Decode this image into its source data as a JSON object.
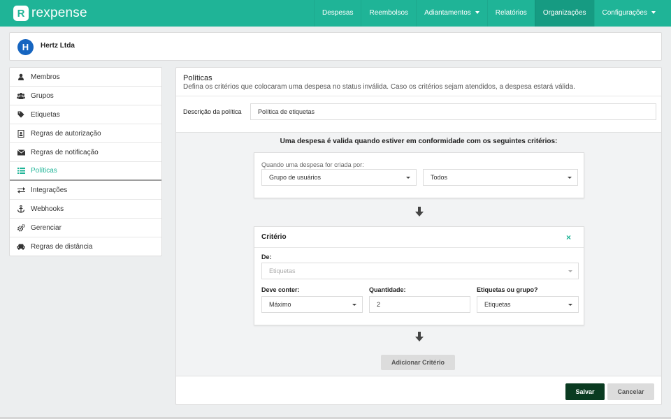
{
  "brand": {
    "logo_letter": "R",
    "name": "rexpense"
  },
  "nav": [
    {
      "label": "Despesas"
    },
    {
      "label": "Reembolsos"
    },
    {
      "label": "Adiantamentos"
    },
    {
      "label": "Relatórios"
    },
    {
      "label": "Organizações"
    },
    {
      "label": "Configurações"
    }
  ],
  "company": {
    "initial": "H",
    "name": "Hertz Ltda"
  },
  "sidebar": {
    "items": [
      {
        "label": "Membros",
        "icon": "user-icon"
      },
      {
        "label": "Grupos",
        "icon": "users-icon"
      },
      {
        "label": "Etiquetas",
        "icon": "tag-icon"
      },
      {
        "label": "Regras de autorização",
        "icon": "badge-icon"
      },
      {
        "label": "Regras de notificação",
        "icon": "envelope-icon"
      },
      {
        "label": "Políticas",
        "icon": "list-icon"
      },
      {
        "label": "Integrações",
        "icon": "exchange-icon"
      },
      {
        "label": "Webhooks",
        "icon": "anchor-icon"
      },
      {
        "label": "Gerenciar",
        "icon": "gears-icon"
      },
      {
        "label": "Regras de distância",
        "icon": "car-icon"
      }
    ]
  },
  "panel": {
    "title": "Políticas",
    "subtitle": "Defina os critérios que colocaram uma despesa no status inválida. Caso os critérios sejam atendidos, a despesa estará válida.",
    "description_label": "Descrição da política",
    "description_value": "Política de etiquetas",
    "rule_heading": "Uma despesa é valida quando estiver em conformidade com os seguintes critérios:",
    "creator": {
      "label": "Quando uma despesa for criada por:",
      "type_value": "Grupo de usuários",
      "who_value": "Todos"
    },
    "criterion": {
      "title": "Critério",
      "close": "×",
      "from_label": "De:",
      "from_value": "Etiquetas",
      "must_label": "Deve conter:",
      "must_value": "Máximo",
      "qty_label": "Quantidade:",
      "qty_value": "2",
      "tags_label": "Etiquetas ou grupo?",
      "tags_value": "Etiquetas"
    },
    "add_criterion": "Adicionar Critério",
    "save": "Salvar",
    "cancel": "Cancelar"
  },
  "colors": {
    "accent": "#1fb497",
    "save": "#0a3b21",
    "avatar": "#1665c0"
  }
}
